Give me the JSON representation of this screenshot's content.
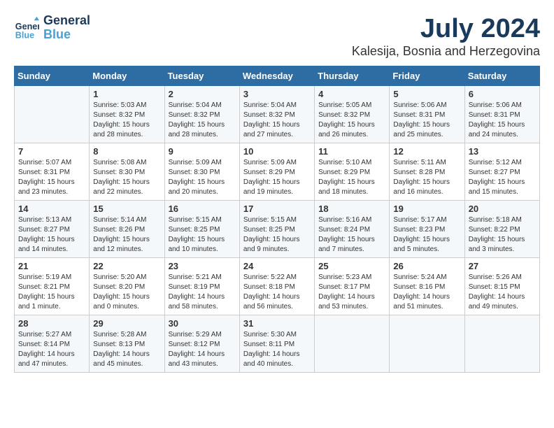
{
  "logo": {
    "line1": "General",
    "line2": "Blue"
  },
  "title": "July 2024",
  "location": "Kalesija, Bosnia and Herzegovina",
  "days_of_week": [
    "Sunday",
    "Monday",
    "Tuesday",
    "Wednesday",
    "Thursday",
    "Friday",
    "Saturday"
  ],
  "weeks": [
    [
      {
        "day": "",
        "content": ""
      },
      {
        "day": "1",
        "content": "Sunrise: 5:03 AM\nSunset: 8:32 PM\nDaylight: 15 hours\nand 28 minutes."
      },
      {
        "day": "2",
        "content": "Sunrise: 5:04 AM\nSunset: 8:32 PM\nDaylight: 15 hours\nand 28 minutes."
      },
      {
        "day": "3",
        "content": "Sunrise: 5:04 AM\nSunset: 8:32 PM\nDaylight: 15 hours\nand 27 minutes."
      },
      {
        "day": "4",
        "content": "Sunrise: 5:05 AM\nSunset: 8:32 PM\nDaylight: 15 hours\nand 26 minutes."
      },
      {
        "day": "5",
        "content": "Sunrise: 5:06 AM\nSunset: 8:31 PM\nDaylight: 15 hours\nand 25 minutes."
      },
      {
        "day": "6",
        "content": "Sunrise: 5:06 AM\nSunset: 8:31 PM\nDaylight: 15 hours\nand 24 minutes."
      }
    ],
    [
      {
        "day": "7",
        "content": "Sunrise: 5:07 AM\nSunset: 8:31 PM\nDaylight: 15 hours\nand 23 minutes."
      },
      {
        "day": "8",
        "content": "Sunrise: 5:08 AM\nSunset: 8:30 PM\nDaylight: 15 hours\nand 22 minutes."
      },
      {
        "day": "9",
        "content": "Sunrise: 5:09 AM\nSunset: 8:30 PM\nDaylight: 15 hours\nand 20 minutes."
      },
      {
        "day": "10",
        "content": "Sunrise: 5:09 AM\nSunset: 8:29 PM\nDaylight: 15 hours\nand 19 minutes."
      },
      {
        "day": "11",
        "content": "Sunrise: 5:10 AM\nSunset: 8:29 PM\nDaylight: 15 hours\nand 18 minutes."
      },
      {
        "day": "12",
        "content": "Sunrise: 5:11 AM\nSunset: 8:28 PM\nDaylight: 15 hours\nand 16 minutes."
      },
      {
        "day": "13",
        "content": "Sunrise: 5:12 AM\nSunset: 8:27 PM\nDaylight: 15 hours\nand 15 minutes."
      }
    ],
    [
      {
        "day": "14",
        "content": "Sunrise: 5:13 AM\nSunset: 8:27 PM\nDaylight: 15 hours\nand 14 minutes."
      },
      {
        "day": "15",
        "content": "Sunrise: 5:14 AM\nSunset: 8:26 PM\nDaylight: 15 hours\nand 12 minutes."
      },
      {
        "day": "16",
        "content": "Sunrise: 5:15 AM\nSunset: 8:25 PM\nDaylight: 15 hours\nand 10 minutes."
      },
      {
        "day": "17",
        "content": "Sunrise: 5:15 AM\nSunset: 8:25 PM\nDaylight: 15 hours\nand 9 minutes."
      },
      {
        "day": "18",
        "content": "Sunrise: 5:16 AM\nSunset: 8:24 PM\nDaylight: 15 hours\nand 7 minutes."
      },
      {
        "day": "19",
        "content": "Sunrise: 5:17 AM\nSunset: 8:23 PM\nDaylight: 15 hours\nand 5 minutes."
      },
      {
        "day": "20",
        "content": "Sunrise: 5:18 AM\nSunset: 8:22 PM\nDaylight: 15 hours\nand 3 minutes."
      }
    ],
    [
      {
        "day": "21",
        "content": "Sunrise: 5:19 AM\nSunset: 8:21 PM\nDaylight: 15 hours\nand 1 minute."
      },
      {
        "day": "22",
        "content": "Sunrise: 5:20 AM\nSunset: 8:20 PM\nDaylight: 15 hours\nand 0 minutes."
      },
      {
        "day": "23",
        "content": "Sunrise: 5:21 AM\nSunset: 8:19 PM\nDaylight: 14 hours\nand 58 minutes."
      },
      {
        "day": "24",
        "content": "Sunrise: 5:22 AM\nSunset: 8:18 PM\nDaylight: 14 hours\nand 56 minutes."
      },
      {
        "day": "25",
        "content": "Sunrise: 5:23 AM\nSunset: 8:17 PM\nDaylight: 14 hours\nand 53 minutes."
      },
      {
        "day": "26",
        "content": "Sunrise: 5:24 AM\nSunset: 8:16 PM\nDaylight: 14 hours\nand 51 minutes."
      },
      {
        "day": "27",
        "content": "Sunrise: 5:26 AM\nSunset: 8:15 PM\nDaylight: 14 hours\nand 49 minutes."
      }
    ],
    [
      {
        "day": "28",
        "content": "Sunrise: 5:27 AM\nSunset: 8:14 PM\nDaylight: 14 hours\nand 47 minutes."
      },
      {
        "day": "29",
        "content": "Sunrise: 5:28 AM\nSunset: 8:13 PM\nDaylight: 14 hours\nand 45 minutes."
      },
      {
        "day": "30",
        "content": "Sunrise: 5:29 AM\nSunset: 8:12 PM\nDaylight: 14 hours\nand 43 minutes."
      },
      {
        "day": "31",
        "content": "Sunrise: 5:30 AM\nSunset: 8:11 PM\nDaylight: 14 hours\nand 40 minutes."
      },
      {
        "day": "",
        "content": ""
      },
      {
        "day": "",
        "content": ""
      },
      {
        "day": "",
        "content": ""
      }
    ]
  ]
}
